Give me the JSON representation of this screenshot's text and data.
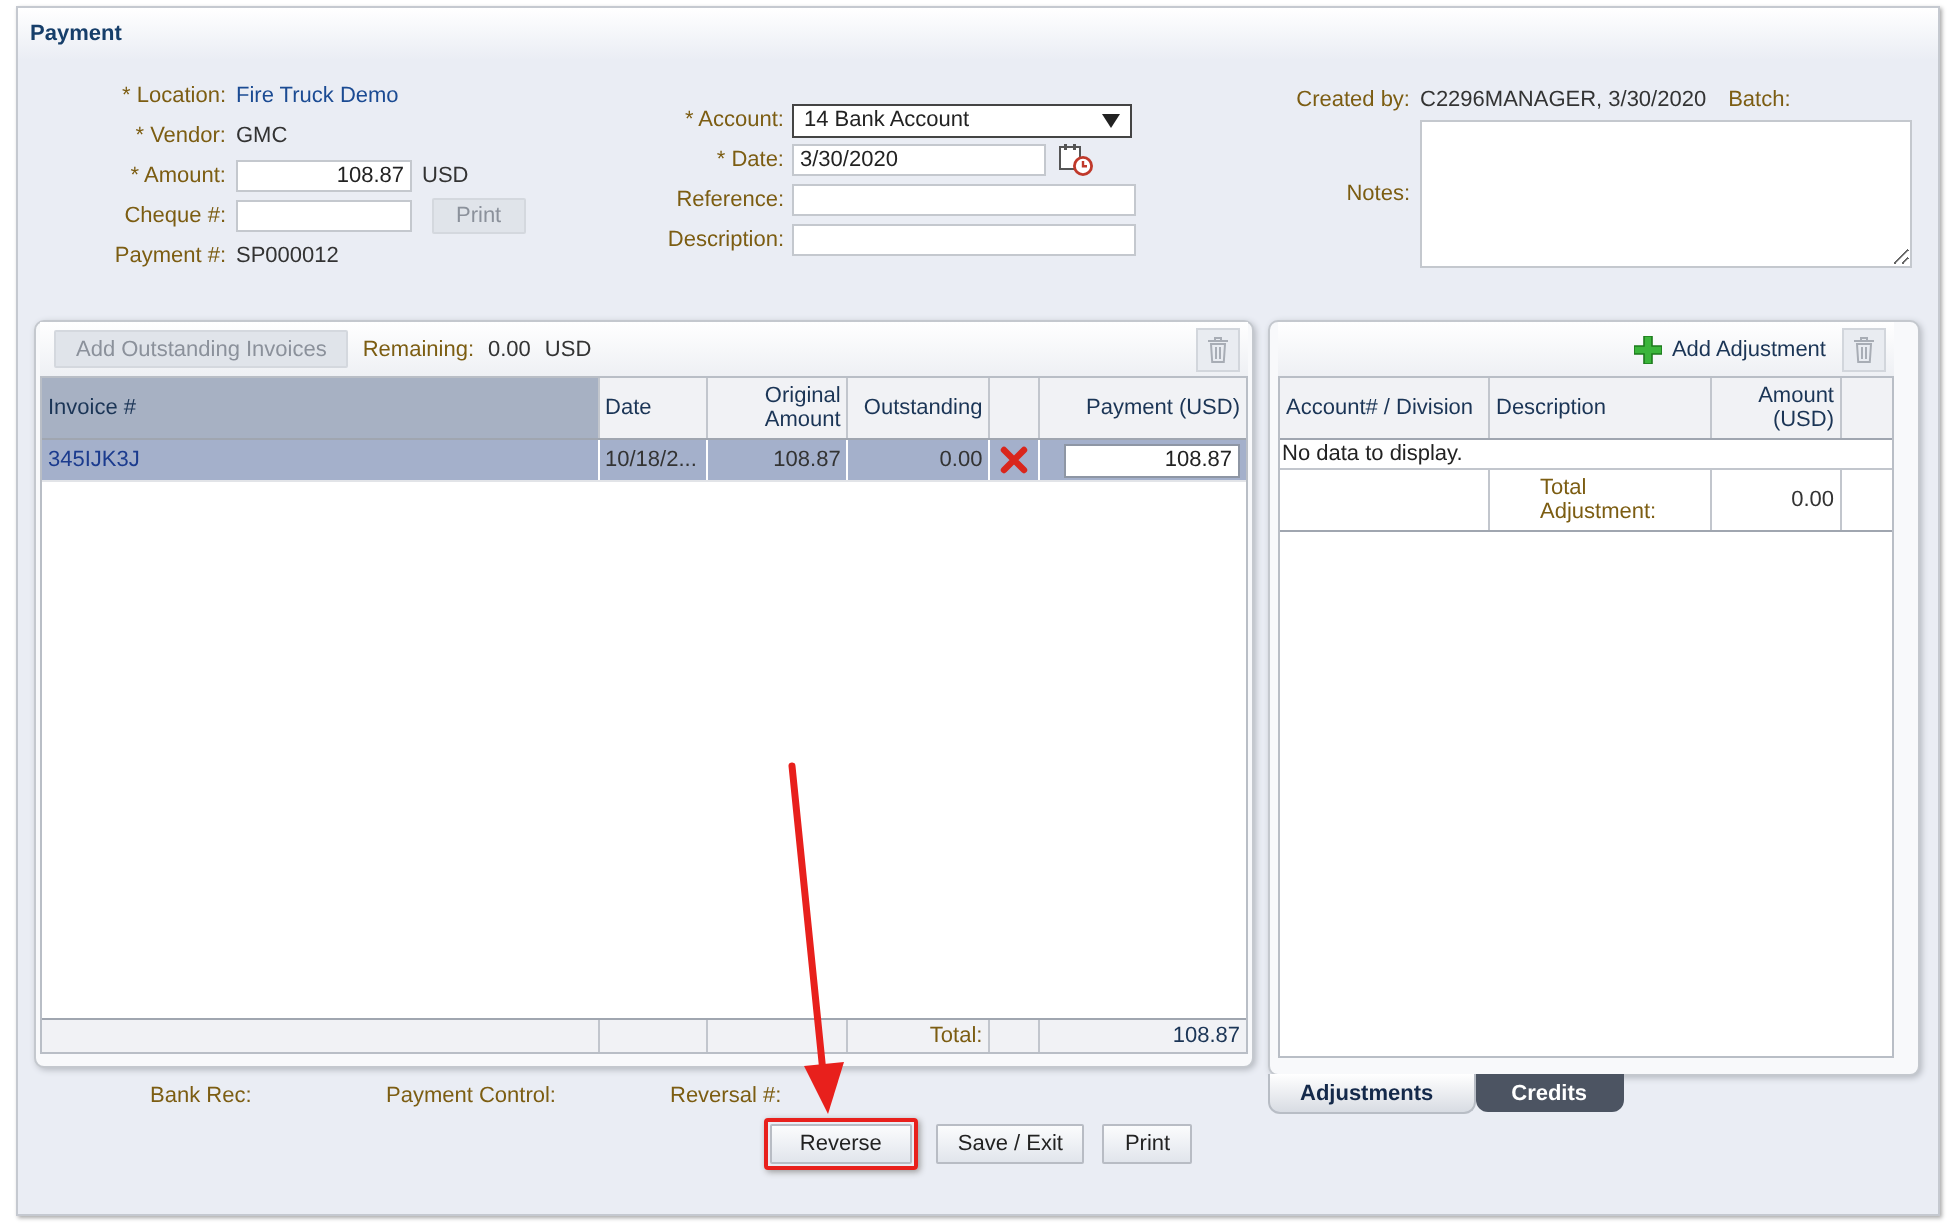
{
  "title": "Payment",
  "left_fields": [
    {
      "label": "* Location:",
      "kind": "link",
      "value": "Fire Truck Demo"
    },
    {
      "label": "* Vendor:",
      "kind": "text",
      "value": "GMC"
    },
    {
      "label": "* Amount:",
      "kind": "input",
      "value": "108.87",
      "unit": "USD"
    },
    {
      "label": "Cheque #:",
      "kind": "input",
      "button": "Print",
      "button_disabled": true
    },
    {
      "label": "Payment #:",
      "kind": "text",
      "value": "SP000012"
    }
  ],
  "mid_fields": [
    {
      "label": "* Account:",
      "kind": "select",
      "value": "14 Bank Account"
    },
    {
      "label": "* Date:",
      "kind": "date",
      "value": "3/30/2020"
    },
    {
      "label": "Reference:",
      "kind": "input"
    },
    {
      "label": "Description:",
      "kind": "input"
    }
  ],
  "info": {
    "created_label": "Created by:",
    "created_value": "C2296MANAGER, 3/30/2020",
    "batch_label": "Batch:",
    "notes_label": "Notes:"
  },
  "invoices": {
    "add_button": "Add Outstanding Invoices",
    "remaining_label": "Remaining:",
    "remaining_value": "0.00",
    "remaining_unit": "USD",
    "columns": [
      "Invoice #",
      "Date",
      "Original Amount",
      "Outstanding",
      "Payment (USD)"
    ],
    "rows": [
      {
        "invoice": "345IJK3J",
        "date": "10/18/2...",
        "original": "108.87",
        "outstanding": "0.00",
        "payment": "108.87",
        "selected": true
      }
    ],
    "total_label": "Total:",
    "total": "108.87"
  },
  "adjustments": {
    "add_button": "Add Adjustment",
    "columns": [
      "Account# / Division",
      "Description",
      "Amount (USD)"
    ],
    "empty_text": "No data to display.",
    "total_label": "Total Adjustment:",
    "total": "0.00"
  },
  "tabs": [
    {
      "label": "Adjustments",
      "selected": true
    },
    {
      "label": "Credits",
      "selected": false
    }
  ],
  "footer_fields": [
    "Bank Rec:",
    "Payment Control:",
    "Reversal #:"
  ],
  "buttons": [
    {
      "label": "Reverse",
      "highlighted": true
    },
    {
      "label": "Save / Exit",
      "highlighted": false
    },
    {
      "label": "Print",
      "highlighted": false
    }
  ]
}
